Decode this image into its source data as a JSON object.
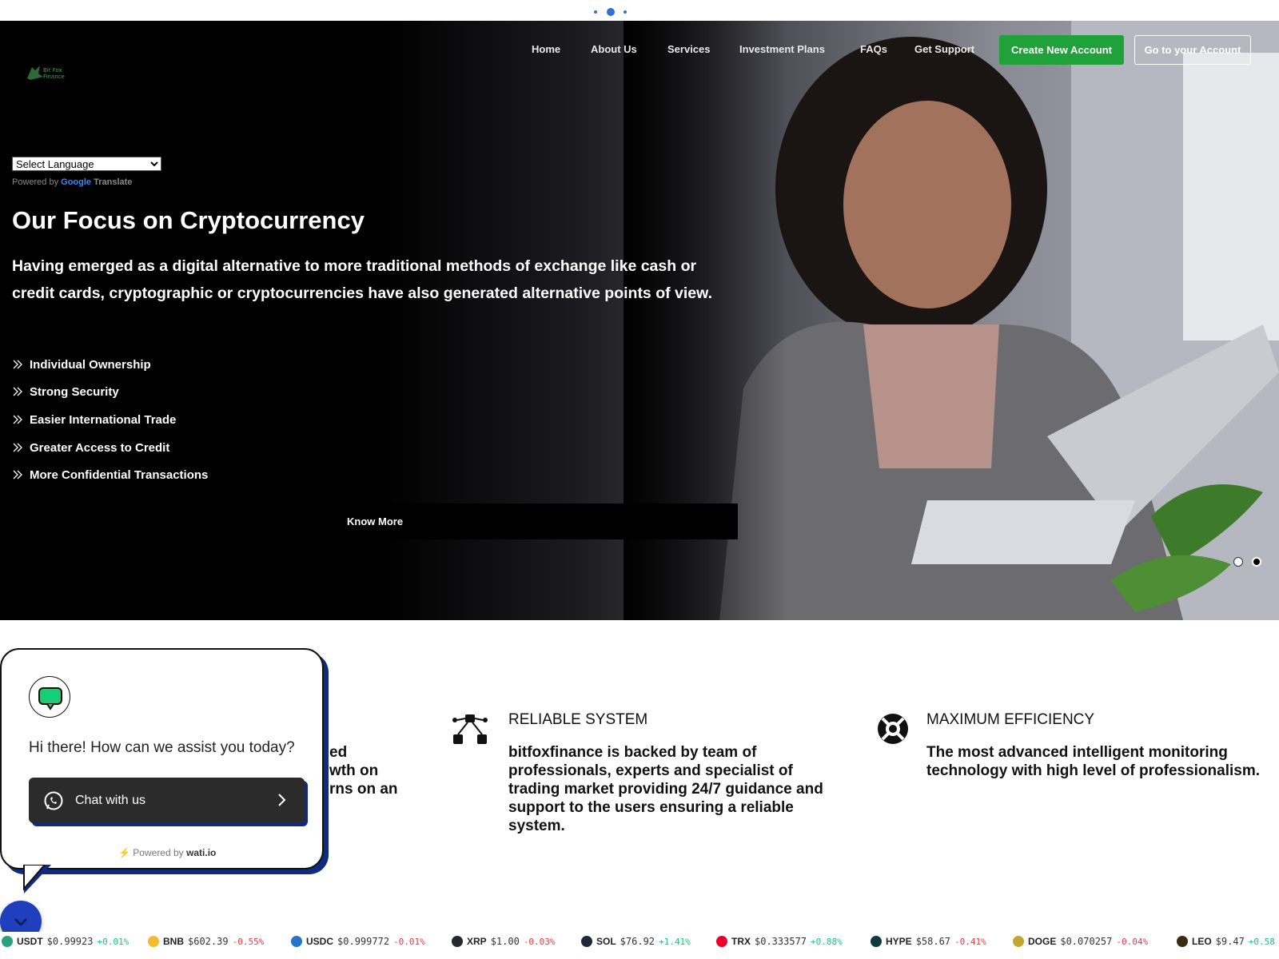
{
  "header": {
    "logo_line1": "Bit Fox",
    "logo_line2": "Finance",
    "nav": [
      "Home",
      "About Us",
      "Services",
      "Investment Plans",
      "FAQs",
      "Get Support"
    ],
    "create_account": "Create New Account",
    "go_account": "Go to your Account"
  },
  "translate": {
    "select_label": "Select Language",
    "powered_by": "Powered by",
    "google": "Google",
    "translate": "Translate"
  },
  "hero": {
    "title": "Our Focus on Cryptocurrency",
    "description": "Having emerged as a digital alternative to more traditional methods of exchange like cash or credit cards, cryptographic or cryptocurrencies have also generated alternative points of view.",
    "features": [
      "Individual Ownership",
      "Strong Security",
      "Easier International Trade",
      "Greater Access to Credit",
      "More Confidential Transactions"
    ],
    "cta": "Know More"
  },
  "columns": [
    {
      "title": "",
      "text_fragments": [
        "ed",
        "wth on",
        "rns on an"
      ]
    },
    {
      "title": "RELIABLE SYSTEM",
      "text": "bitfoxfinance is backed by team of professionals, experts and specialist of trading market providing 24/7 guidance and support to the users ensuring a reliable system."
    },
    {
      "title": "MAXIMUM EFFICIENCY",
      "text": "The most advanced intelligent monitoring technology with high level of professionalism."
    }
  ],
  "chat": {
    "greeting": "Hi there! How can we assist you today?",
    "button": "Chat with us",
    "powered_by": "Powered by",
    "brand": "wati.io"
  },
  "ticker": [
    {
      "sym": "USDT",
      "price": "$0.99923",
      "change": "+0.01%",
      "up": true,
      "color": "#26a17b"
    },
    {
      "sym": "BNB",
      "price": "$602.39",
      "change": "-0.55%",
      "up": false,
      "color": "#f3ba2f"
    },
    {
      "sym": "USDC",
      "price": "$0.999772",
      "change": "-0.01%",
      "up": false,
      "color": "#2775ca"
    },
    {
      "sym": "XRP",
      "price": "$1.00",
      "change": "-0.03%",
      "up": false,
      "color": "#23292f"
    },
    {
      "sym": "SOL",
      "price": "$76.92",
      "change": "+1.41%",
      "up": true,
      "color": "#1e2a3a"
    },
    {
      "sym": "TRX",
      "price": "$0.333577",
      "change": "+0.88%",
      "up": true,
      "color": "#eb0029"
    },
    {
      "sym": "HYPE",
      "price": "$58.67",
      "change": "-0.41%",
      "up": false,
      "color": "#0f3b3a"
    },
    {
      "sym": "DOGE",
      "price": "$0.070257",
      "change": "-0.04%",
      "up": false,
      "color": "#c2a633"
    },
    {
      "sym": "LEO",
      "price": "$9.47",
      "change": "+0.58",
      "up": true,
      "color": "#3a2b12"
    }
  ],
  "colors": {
    "accent_green": "#1fa23a",
    "chat_blue": "#0f2a7e",
    "up": "#16c784",
    "down": "#ea3943"
  }
}
